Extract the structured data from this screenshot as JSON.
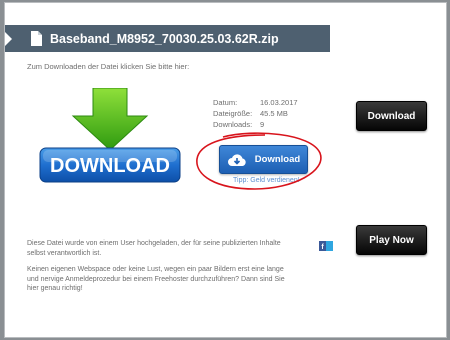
{
  "file": {
    "name": "Baseband_M8952_70030.25.03.62R.zip"
  },
  "instruction": "Zum Downloaden der Datei klicken Sie bitte hier:",
  "big_download_label": "DOWNLOAD",
  "meta": [
    {
      "key": "Datum:",
      "value": "16.03.2017"
    },
    {
      "key": "Dateigröße:",
      "value": "45.5 MB"
    },
    {
      "key": "Downloads:",
      "value": "9"
    }
  ],
  "download_button_label": "Download",
  "tip": "Tipp: Geld verdienen!",
  "side_buttons": {
    "download_label": "Download",
    "play_label": "Play Now"
  },
  "info": {
    "line1": "Diese Datei wurde von einem User hochgeladen, der für seine publizierten Inhalte selbst verantwortlich ist.",
    "line2": "Keinen eigenen Webspace oder keine Lust, wegen ein paar Bildern erst eine lange und nervige Anmeldeprozedur bei einem Freehoster durchzuführen? Dann sind Sie hier genau richtig!"
  },
  "colors": {
    "header_bg": "#4e6070",
    "button_blue": "#2a6fc4",
    "arrow_green": "#47b21f",
    "annotation_red": "#d8141c"
  }
}
